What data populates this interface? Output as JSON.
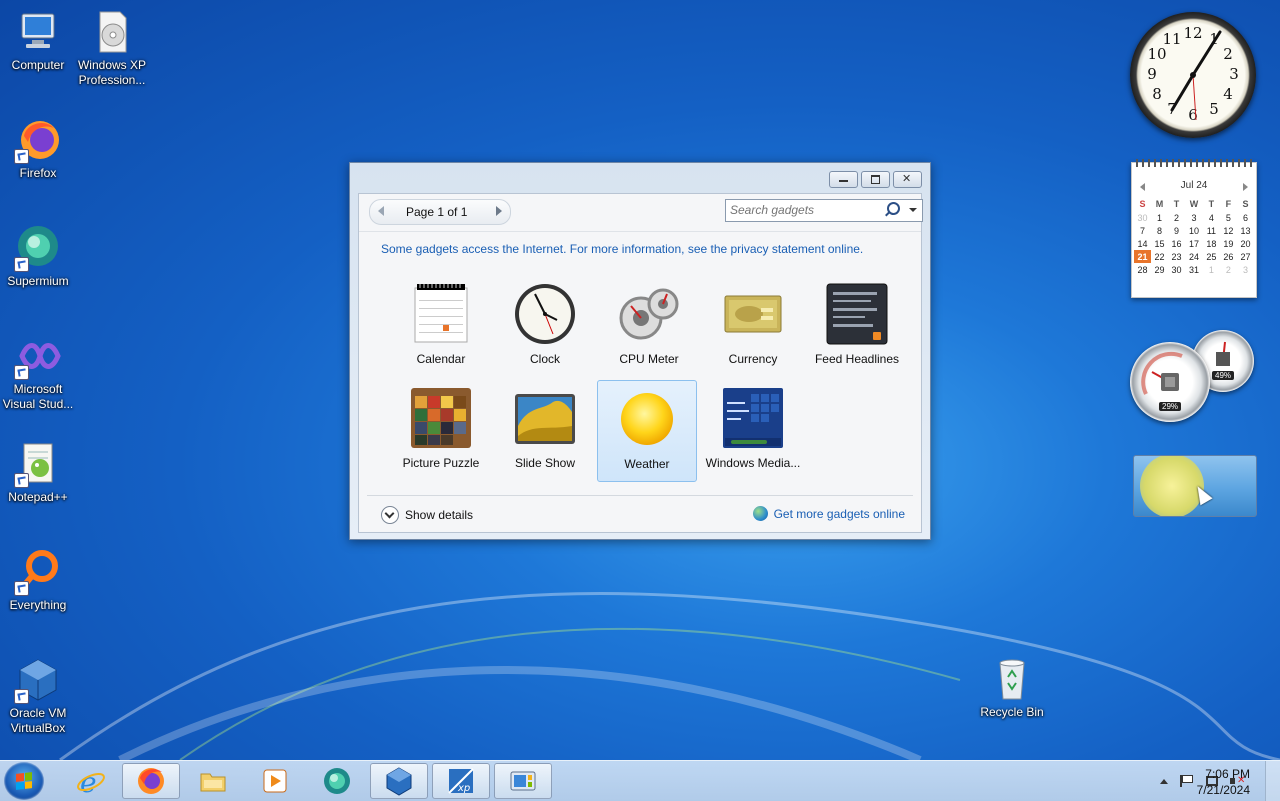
{
  "desktop": {
    "icons": [
      {
        "label": "Computer"
      },
      {
        "label": "Windows XP Profession..."
      },
      {
        "label": "Firefox"
      },
      {
        "label": "Supermium"
      },
      {
        "label": "Microsoft Visual Stud..."
      },
      {
        "label": "Notepad++"
      },
      {
        "label": "Everything"
      },
      {
        "label": "Oracle VM VirtualBox"
      },
      {
        "label": "Recycle Bin"
      }
    ]
  },
  "gadget_window": {
    "pager_label": "Page 1 of 1",
    "search_placeholder": "Search gadgets",
    "notice": "Some gadgets access the Internet.  For more information, see the privacy statement online.",
    "gadgets": [
      {
        "label": "Calendar"
      },
      {
        "label": "Clock"
      },
      {
        "label": "CPU Meter"
      },
      {
        "label": "Currency"
      },
      {
        "label": "Feed Headlines"
      },
      {
        "label": "Picture Puzzle"
      },
      {
        "label": "Slide Show"
      },
      {
        "label": "Weather",
        "selected": true
      },
      {
        "label": "Windows Media..."
      }
    ],
    "show_details": "Show details",
    "get_more": "Get more gadgets online"
  },
  "desktop_gadgets": {
    "calendar": {
      "month": "Jul 24",
      "weekdays": [
        "S",
        "M",
        "T",
        "W",
        "T",
        "F",
        "S"
      ],
      "weeks": [
        [
          "30",
          "1",
          "2",
          "3",
          "4",
          "5",
          "6"
        ],
        [
          "7",
          "8",
          "9",
          "10",
          "11",
          "12",
          "13"
        ],
        [
          "14",
          "15",
          "16",
          "17",
          "18",
          "19",
          "20"
        ],
        [
          "21",
          "22",
          "23",
          "24",
          "25",
          "26",
          "27"
        ],
        [
          "28",
          "29",
          "30",
          "31",
          "1",
          "2",
          "3"
        ]
      ],
      "today": "21"
    },
    "cpu_meter": {
      "cpu_percent": "29%",
      "memory_percent": "49%"
    }
  },
  "taskbar": {
    "time": "7:06 PM",
    "date": "7/21/2024"
  },
  "colors": {
    "desktop_blue": "#1e78d8",
    "link_blue": "#1a5fb4",
    "today_orange": "#e8742a"
  }
}
